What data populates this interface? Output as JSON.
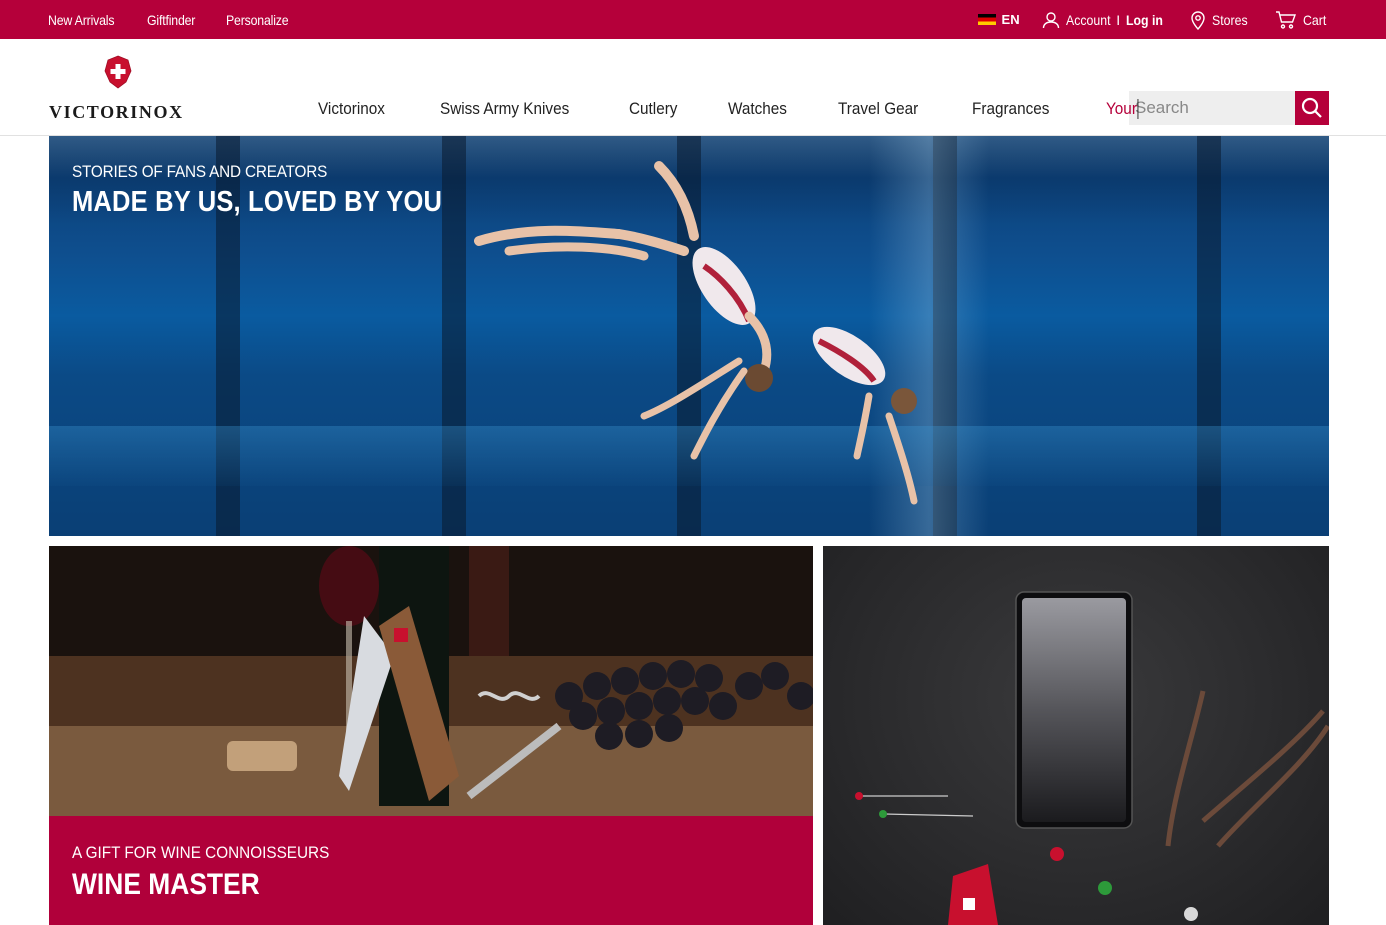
{
  "topbar": {
    "links": [
      "New Arrivals",
      "Giftfinder",
      "Personalize"
    ],
    "language": "EN",
    "account_label": "Account",
    "separator": "I",
    "login_label": "Log in",
    "stores_label": "Stores",
    "cart_label": "Cart",
    "background": "#b5003a"
  },
  "header": {
    "brand": "VICTORINOX",
    "nav": [
      "Victorinox",
      "Swiss Army Knives",
      "Cutlery",
      "Watches",
      "Travel Gear",
      "Fragrances",
      "Your"
    ],
    "search_placeholder": "Search"
  },
  "hero": {
    "kicker": "STORIES OF FANS AND CREATORS",
    "headline": "MADE BY US, LOVED BY YOU"
  },
  "tiles": {
    "wine": {
      "kicker": "A GIFT FOR WINE CONNOISSEURS",
      "title": "WINE MASTER",
      "caption_color": "#b0003a"
    }
  },
  "colors": {
    "accent": "#b5003a"
  }
}
